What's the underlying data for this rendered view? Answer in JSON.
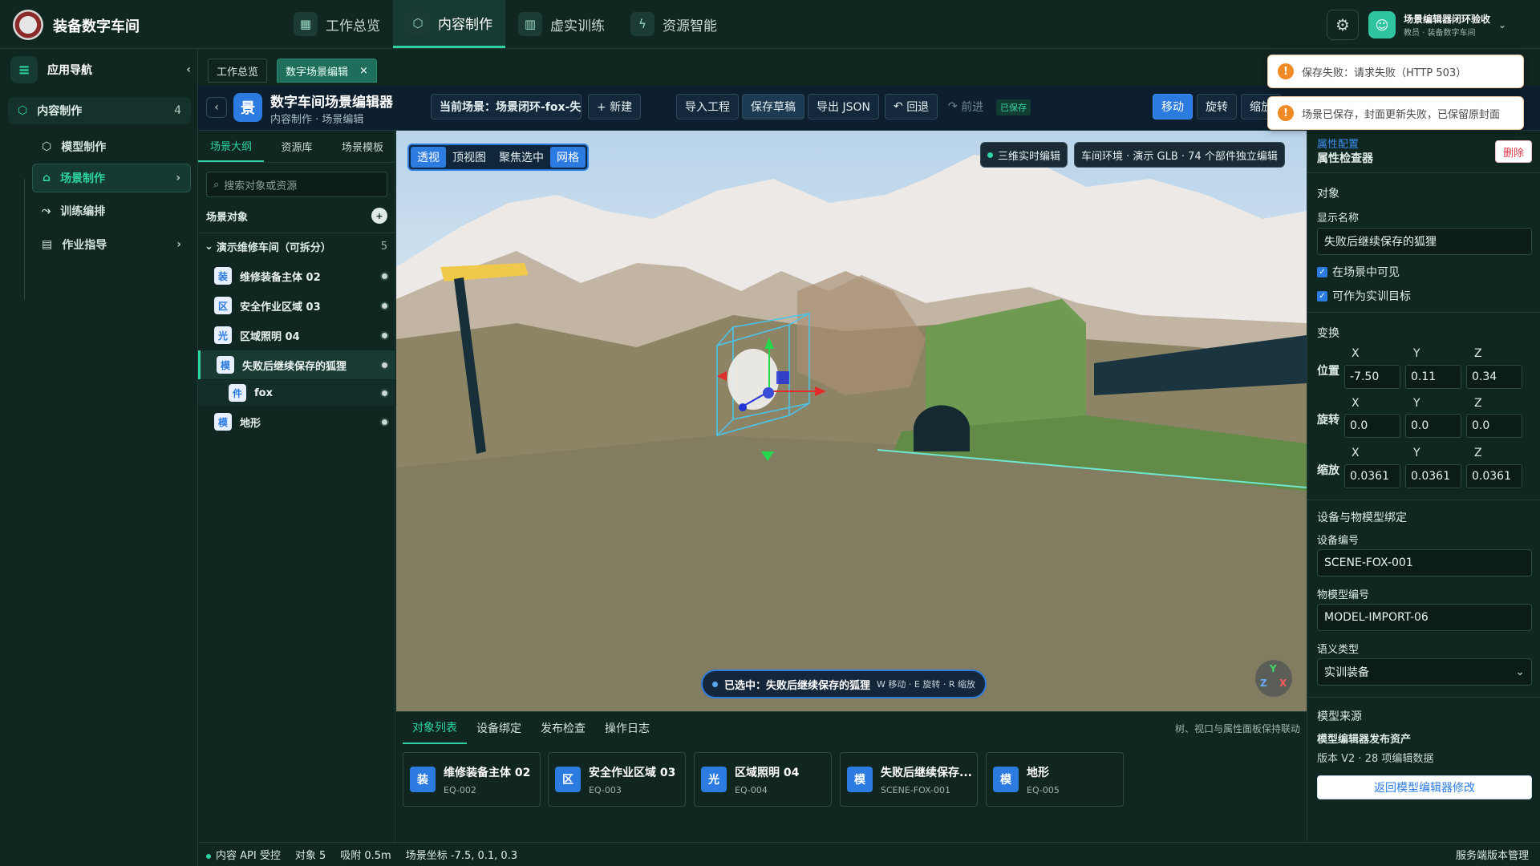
{
  "app": {
    "title": "装备数字车间"
  },
  "topnav": {
    "items": [
      {
        "label": "工作总览",
        "icon": "grid-icon"
      },
      {
        "label": "内容制作",
        "icon": "cube-icon",
        "active": true
      },
      {
        "label": "虚实训练",
        "icon": "book-icon"
      },
      {
        "label": "资源智能",
        "icon": "bolt-icon"
      }
    ]
  },
  "user": {
    "name": "场景编辑器闭环验收",
    "role": "教员 · 装备数字车间"
  },
  "sidebar": {
    "title": "应用导航",
    "section": {
      "label": "内容制作",
      "count": "4"
    },
    "items": [
      {
        "label": "模型制作"
      },
      {
        "label": "场景制作",
        "active": true
      },
      {
        "label": "训练编排"
      },
      {
        "label": "作业指导"
      }
    ]
  },
  "tabs": [
    {
      "label": "工作总览"
    },
    {
      "label": "数字场景编辑",
      "active": true
    }
  ],
  "toolbar": {
    "icon_char": "景",
    "title": "数字车间场景编辑器",
    "subtitle": "内容制作 · 场景编辑",
    "current_scene": "当前场景：场景闭环-fox-失败...",
    "new": "+ 新建",
    "import": "导入工程",
    "save_draft": "保存草稿",
    "export_json": "导出 JSON",
    "undo": "回退",
    "redo": "前进",
    "saved": "已保存",
    "move": "移动",
    "rotate": "旋转",
    "scale": "缩放"
  },
  "toasts": [
    {
      "text": "保存失败：请求失败（HTTP 503）"
    },
    {
      "text": "场景已保存，封面更新失败，已保留原封面"
    }
  ],
  "outline": {
    "tabs": [
      "场景大纲",
      "资源库",
      "场景模板"
    ],
    "search_placeholder": "搜索对象或资源",
    "heading": "场景对象",
    "group": {
      "label": "演示维修车间（可拆分）",
      "count": "5"
    },
    "nodes": [
      {
        "badge": "装",
        "label": "维修装备主体 02"
      },
      {
        "badge": "区",
        "label": "安全作业区域 03"
      },
      {
        "badge": "光",
        "label": "区域照明 04"
      },
      {
        "badge": "模",
        "label": "失败后继续保存的狐狸",
        "selected": true
      },
      {
        "badge": "件",
        "label": "fox",
        "child": true
      },
      {
        "badge": "模",
        "label": "地形"
      }
    ]
  },
  "viewport": {
    "tools": [
      "透视",
      "顶视图",
      "聚焦选中",
      "网格"
    ],
    "chip_live": "三维实时编辑",
    "chip_env": "车间环境 · 演示 GLB · 74 个部件独立编辑",
    "selected_label": "已选中：失败后继续保存的狐狸",
    "hint": "W 移动 · E 旋转 · R 缩放",
    "gizmo": {
      "y": "Y",
      "z": "Z",
      "x": "X"
    }
  },
  "bottom": {
    "tabs": [
      "对象列表",
      "设备绑定",
      "发布检查",
      "操作日志"
    ],
    "note": "树、视口与属性面板保持联动",
    "cards": [
      {
        "badge": "装",
        "title": "维修装备主体 02",
        "code": "EQ-002"
      },
      {
        "badge": "区",
        "title": "安全作业区域 03",
        "code": "EQ-003"
      },
      {
        "badge": "光",
        "title": "区域照明 04",
        "code": "EQ-004"
      },
      {
        "badge": "模",
        "title": "失败后继续保存...",
        "code": "SCENE-FOX-001"
      },
      {
        "badge": "模",
        "title": "地形",
        "code": "EQ-005"
      }
    ]
  },
  "props": {
    "section_label": "属性配置",
    "title": "属性检查器",
    "delete": "删除",
    "object_heading": "对象",
    "display_name_label": "显示名称",
    "display_name": "失败后继续保存的狐狸",
    "visible_label": "在场景中可见",
    "target_label": "可作为实训目标",
    "transform_heading": "变换",
    "axes": [
      "X",
      "Y",
      "Z"
    ],
    "position_label": "位置",
    "position": [
      "-7.50",
      "0.11",
      "0.34"
    ],
    "rotation_label": "旋转",
    "rotation": [
      "0.0",
      "0.0",
      "0.0"
    ],
    "scale_label": "缩放",
    "scale": [
      "0.0361",
      "0.0361",
      "0.0361"
    ],
    "binding_heading": "设备与物模型绑定",
    "device_code_label": "设备编号",
    "device_code": "SCENE-FOX-001",
    "model_code_label": "物模型编号",
    "model_code": "MODEL-IMPORT-06",
    "semantic_label": "语义类型",
    "semantic_value": "实训装备",
    "source_heading": "模型来源",
    "source_title": "模型编辑器发布资产",
    "source_version": "版本 V2 · 28 项编辑数据",
    "return_button": "返回模型编辑器修改"
  },
  "statusbar": {
    "api": "内容 API 受控",
    "objects": "对象 5",
    "snap": "吸附 0.5m",
    "coords": "场景坐标 -7.5, 0.1, 0.3",
    "right": "服务端版本管理"
  },
  "colors": {
    "accent": "#2ed3a4",
    "primary": "#2b7be0",
    "danger": "#e0384a",
    "warning": "#f08a24"
  }
}
